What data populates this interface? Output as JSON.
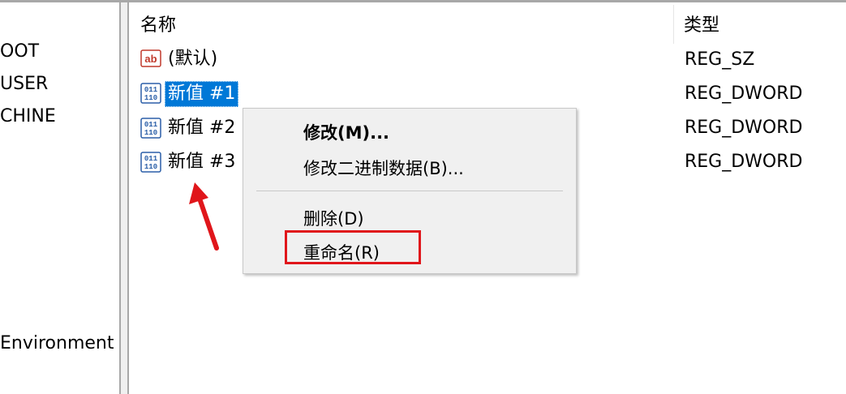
{
  "tree": {
    "items": [
      "OOT",
      "USER",
      "CHINE",
      "Environment"
    ]
  },
  "list": {
    "headers": {
      "name": "名称",
      "type": "类型"
    },
    "rows": [
      {
        "name": "(默认)",
        "type": "REG_SZ",
        "icon": "string-value-icon"
      },
      {
        "name": "新值 #1",
        "type": "REG_DWORD",
        "icon": "binary-value-icon",
        "selected": true
      },
      {
        "name": "新值 #2",
        "type": "REG_DWORD",
        "icon": "binary-value-icon"
      },
      {
        "name": "新值 #3",
        "type": "REG_DWORD",
        "icon": "binary-value-icon"
      }
    ]
  },
  "context_menu": {
    "items": [
      "修改(M)...",
      "修改二进制数据(B)...",
      "删除(D)",
      "重命名(R)"
    ]
  },
  "colors": {
    "selection": "#0078d7",
    "annotation": "#e0161b",
    "menu_bg": "#f0f0f0"
  }
}
